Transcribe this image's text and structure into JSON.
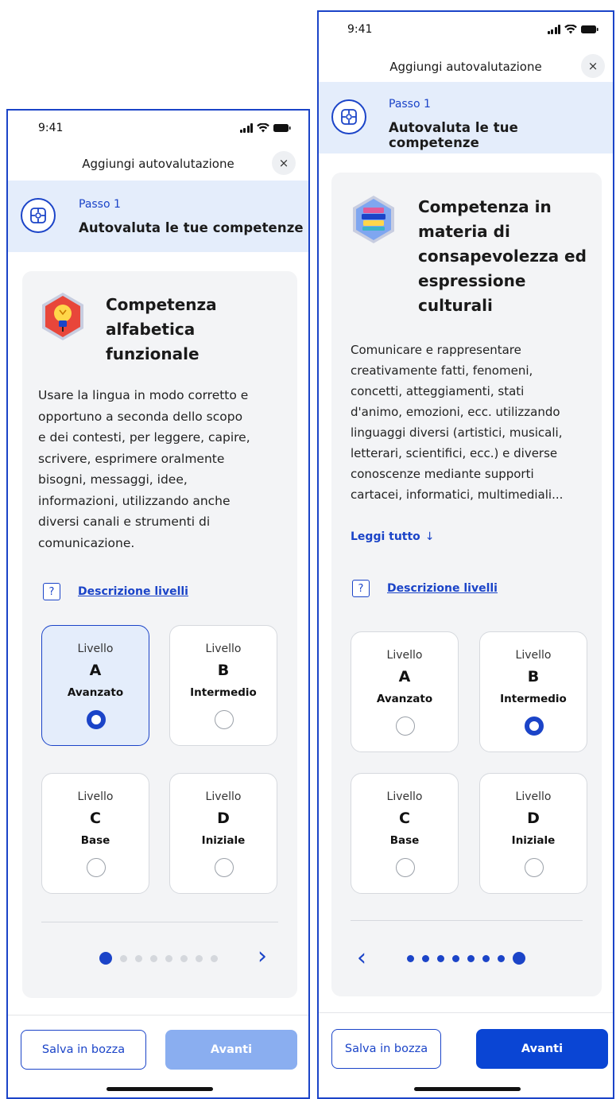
{
  "colors": {
    "primary": "#1b44c8",
    "button_enabled": "#0a45d4",
    "button_disabled": "#8aaef0",
    "banner_bg": "#e4edfb",
    "card_bg": "#f3f4f6"
  },
  "screens": [
    {
      "status": {
        "time": "9:41"
      },
      "header": {
        "title": "Aggiungi autovalutazione",
        "close": "×"
      },
      "step": {
        "label": "Passo 1",
        "title": "Autovaluta le tue competenze",
        "icon": "puzzle-icon"
      },
      "competence": {
        "badge_icon": "lightbulb-pencil-badge-icon",
        "title_lines": [
          "Competenza",
          "alfabetica",
          "funzionale"
        ],
        "description_lines": [
          "Usare la lingua in modo corretto e",
          "opportuno a seconda dello scopo",
          "e dei contesti, per leggere, capire,",
          "scrivere, esprimere oralmente",
          "bisogni, messaggi, idee,",
          "informazioni, utilizzando anche",
          "diversi canali e strumenti di",
          "comunicazione."
        ]
      },
      "help": {
        "icon": "?",
        "link": "Descrizione livelli"
      },
      "levels": [
        {
          "word": "Livello",
          "letter": "A",
          "name": "Avanzato",
          "selected": true
        },
        {
          "word": "Livello",
          "letter": "B",
          "name": "Intermedio",
          "selected": false
        },
        {
          "word": "Livello",
          "letter": "C",
          "name": "Base",
          "selected": false
        },
        {
          "word": "Livello",
          "letter": "D",
          "name": "Iniziale",
          "selected": false
        }
      ],
      "pager": {
        "current": 1,
        "total": 8,
        "next": "›"
      },
      "footer": {
        "draft": "Salva in bozza",
        "next": "Avanti",
        "next_enabled": false
      }
    },
    {
      "status": {
        "time": "9:41"
      },
      "header": {
        "title": "Aggiungi autovalutazione",
        "close": "×"
      },
      "step": {
        "label": "Passo 1",
        "title": "Autovaluta le tue competenze",
        "icon": "puzzle-icon"
      },
      "competence": {
        "badge_icon": "books-badge-icon",
        "title_lines": [
          "Competenza in",
          "materia di",
          "consapevolezza ed",
          "espressione",
          "culturali"
        ],
        "description_lines": [
          "Comunicare e rappresentare",
          "creativamente fatti, fenomeni,",
          "concetti, atteggiamenti, stati",
          "d'animo, emozioni, ecc. utilizzando",
          "linguaggi diversi (artistici, musicali,",
          "letterari, scientifici, ecc.) e diverse",
          "conoscenze mediante supporti",
          "cartacei, informatici, multimediali..."
        ],
        "read_more": "Leggi tutto",
        "read_more_arrow": "↓"
      },
      "help": {
        "icon": "?",
        "link": "Descrizione livelli"
      },
      "levels": [
        {
          "word": "Livello",
          "letter": "A",
          "name": "Avanzato",
          "selected": false
        },
        {
          "word": "Livello",
          "letter": "B",
          "name": "Intermedio",
          "selected": true
        },
        {
          "word": "Livello",
          "letter": "C",
          "name": "Base",
          "selected": false
        },
        {
          "word": "Livello",
          "letter": "D",
          "name": "Iniziale",
          "selected": false
        }
      ],
      "pager": {
        "current": 8,
        "total": 8,
        "prev": "‹"
      },
      "footer": {
        "draft": "Salva in bozza",
        "next": "Avanti",
        "next_enabled": true
      }
    }
  ]
}
